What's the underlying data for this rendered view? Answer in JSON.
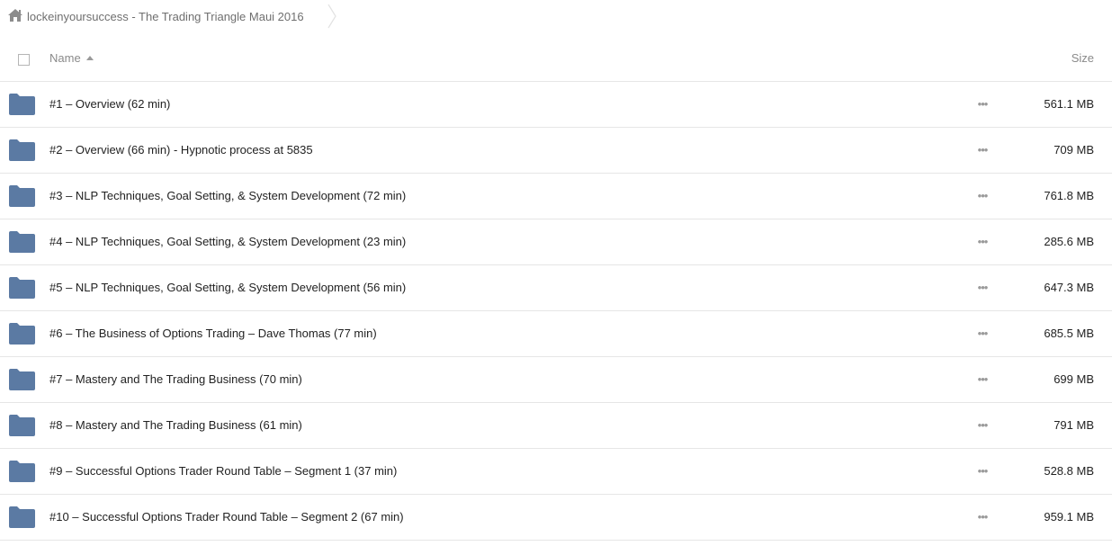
{
  "breadcrumb": {
    "home_icon": "home-icon",
    "label": "lockeinyoursuccess - The Trading Triangle Maui 2016"
  },
  "header": {
    "name_label": "Name",
    "size_label": "Size",
    "sort": "ascending"
  },
  "colors": {
    "folder": "#5b7aa3",
    "text": "#222222",
    "muted": "#8a8a8a",
    "divider": "#e6e6e6"
  },
  "files": [
    {
      "name": "#1 – Overview (62 min)",
      "size": "561.1 MB"
    },
    {
      "name": "#2 – Overview (66 min) - Hypnotic process at 5835",
      "size": "709 MB"
    },
    {
      "name": "#3 – NLP Techniques, Goal Setting, & System Development (72 min)",
      "size": "761.8 MB"
    },
    {
      "name": "#4 – NLP Techniques, Goal Setting, & System Development (23 min)",
      "size": "285.6 MB"
    },
    {
      "name": "#5 – NLP Techniques, Goal Setting, & System Development (56 min)",
      "size": "647.3 MB"
    },
    {
      "name": "#6 – The Business of Options Trading – Dave Thomas (77 min)",
      "size": "685.5 MB"
    },
    {
      "name": "#7 – Mastery and The Trading Business (70 min)",
      "size": "699 MB"
    },
    {
      "name": "#8 – Mastery and The Trading Business (61 min)",
      "size": "791 MB"
    },
    {
      "name": "#9 – Successful Options Trader Round Table – Segment 1 (37 min)",
      "size": "528.8 MB"
    },
    {
      "name": "#10 – Successful Options Trader Round Table – Segment 2 (67 min)",
      "size": "959.1 MB"
    }
  ]
}
